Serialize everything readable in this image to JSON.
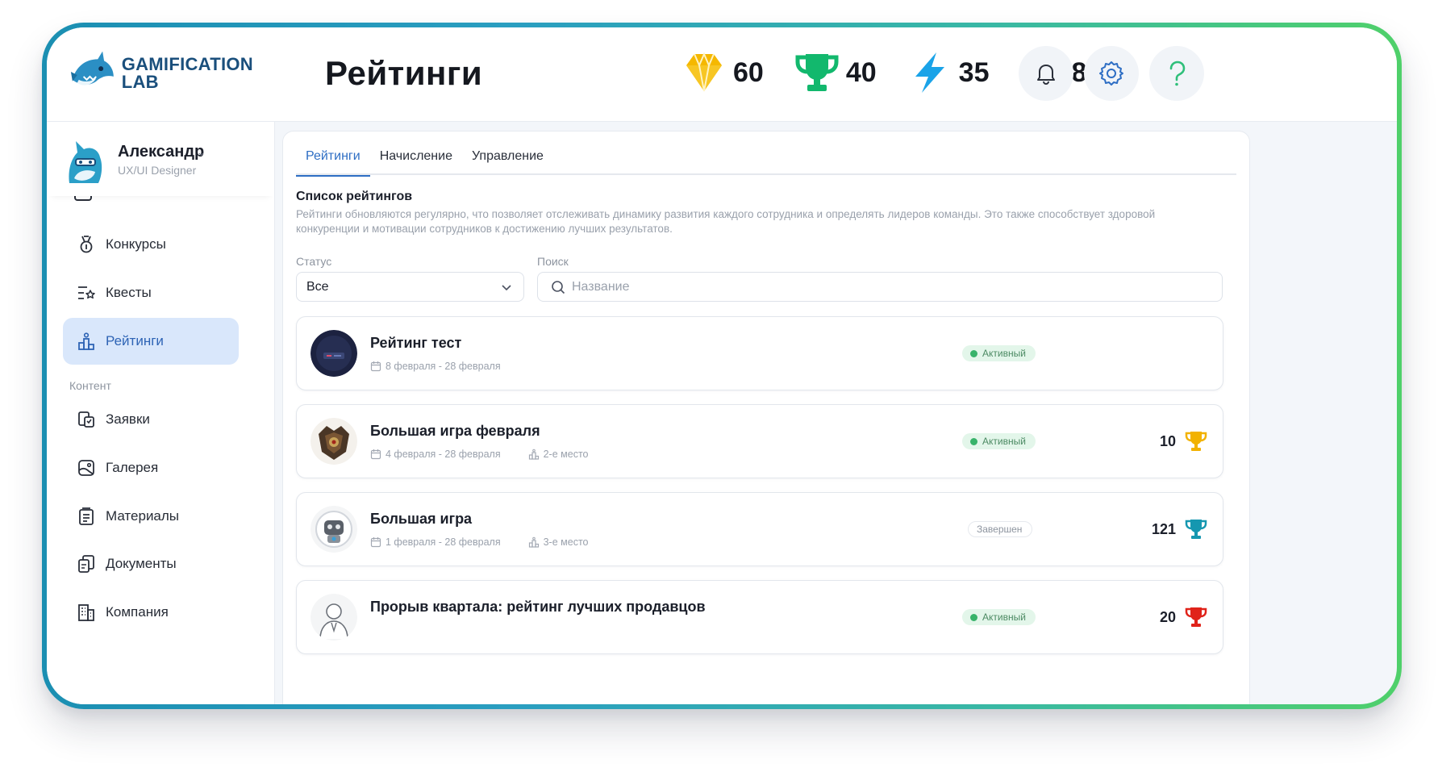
{
  "app": {
    "logo_line1": "GAMIFICATION",
    "logo_line2": "LAB",
    "page_title": "Рейтинги"
  },
  "counters": [
    {
      "icon": "diamond-icon",
      "value": "60",
      "color": "#f5b800"
    },
    {
      "icon": "trophy-icon",
      "value": "40",
      "color": "#12b86d"
    },
    {
      "icon": "lightning-icon",
      "value": "35",
      "color": "#1aa3e8"
    },
    {
      "icon": "gift-icon",
      "value": "8",
      "color": "#0e8a3d"
    }
  ],
  "header_buttons": [
    {
      "icon": "bell-icon"
    },
    {
      "icon": "gear-icon",
      "color": "#2e6ec4"
    },
    {
      "icon": "question-icon",
      "color": "#2fbf7a"
    }
  ],
  "user": {
    "name": "Александр",
    "role": "UX/UI Designer"
  },
  "sidebar": {
    "items": [
      {
        "label": "Конкурсы",
        "icon": "medal-icon"
      },
      {
        "label": "Квесты",
        "icon": "quest-list-icon"
      },
      {
        "label": "Рейтинги",
        "icon": "podium-icon",
        "active": true
      }
    ],
    "section_label": "Контент",
    "content_items": [
      {
        "label": "Заявки",
        "icon": "requests-icon"
      },
      {
        "label": "Галерея",
        "icon": "gallery-icon"
      },
      {
        "label": "Материалы",
        "icon": "materials-icon"
      },
      {
        "label": "Документы",
        "icon": "documents-icon"
      },
      {
        "label": "Компания",
        "icon": "company-icon"
      }
    ]
  },
  "tabs": [
    "Рейтинги",
    "Начисление",
    "Управление"
  ],
  "list": {
    "title": "Список рейтингов",
    "description": "Рейтинги обновляются регулярно, что позволяет отслеживать динамику развития каждого сотрудника и определять лидеров команды. Это также способствует здоровой конкуренции и мотивации сотрудников к достижению лучших результатов."
  },
  "filters": {
    "status_label": "Статус",
    "status_value": "Все",
    "search_label": "Поиск",
    "search_placeholder": "Название"
  },
  "ratings": [
    {
      "title": "Рейтинг тест",
      "dates": "8 февраля - 28 февраля",
      "place": "",
      "status": "Активный",
      "score": "",
      "trophy_color": ""
    },
    {
      "title": "Большая игра февраля",
      "dates": "4 февраля - 28 февраля",
      "place": "2-е место",
      "status": "Активный",
      "score": "10",
      "trophy_color": "#f2b200"
    },
    {
      "title": "Большая игра",
      "dates": "1 февраля - 28 февраля",
      "place": "3-е место",
      "status": "Завершен",
      "score": "121",
      "trophy_color": "#1597b0"
    },
    {
      "title": "Прорыв квартала: рейтинг лучших продавцов",
      "dates": "",
      "place": "",
      "status": "Активный",
      "score": "20",
      "trophy_color": "#e0231a"
    }
  ]
}
